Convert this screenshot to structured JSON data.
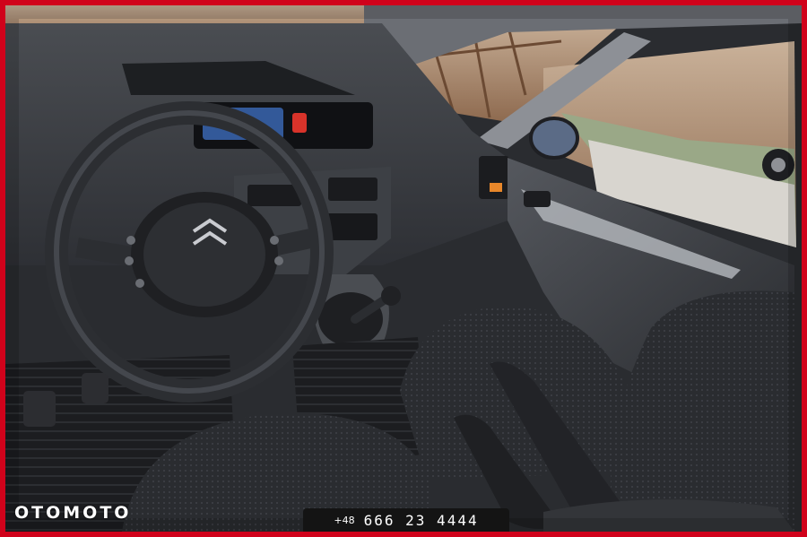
{
  "image": {
    "subject": "car-interior-photo",
    "colors": {
      "frame": "#d0021b",
      "dashboard": "#3a3d42",
      "seat_fabric": "#2b2d31",
      "window_glass": "#b7a38a",
      "accent_orange": "#e8872a"
    }
  },
  "watermark": {
    "brand": "OTOMOTO"
  },
  "contact": {
    "phone_prefix": "+48",
    "phone_number": "666 23 4444"
  }
}
